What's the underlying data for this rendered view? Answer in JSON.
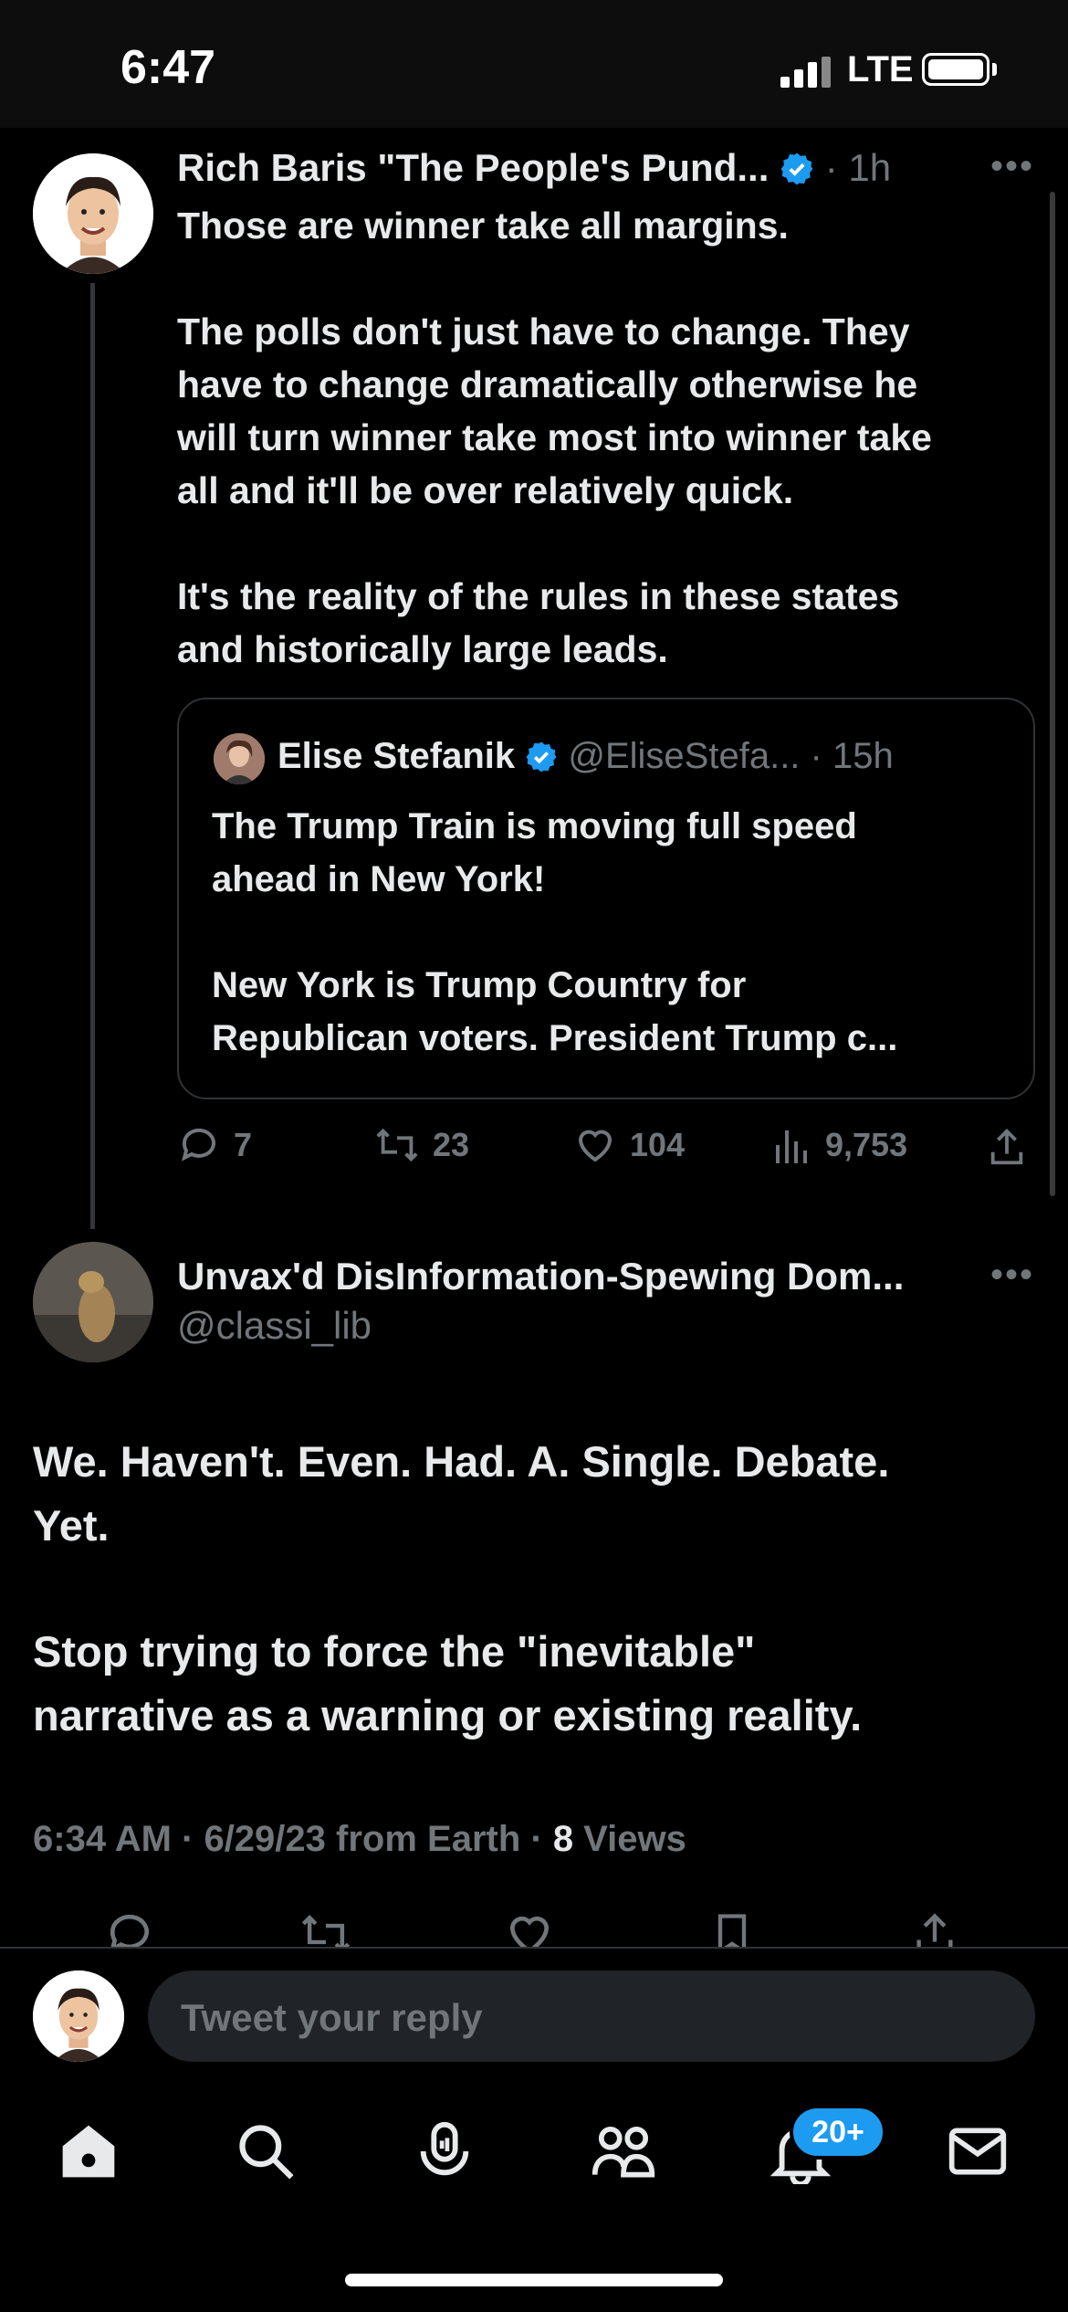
{
  "status_bar": {
    "time": "6:47",
    "network": "LTE"
  },
  "post1": {
    "author_name": "Rich Baris \"The People's Pund...",
    "time": "· 1h",
    "lines": [
      "Those are winner take all margins.",
      "The polls don't just have to change. They",
      "have to change dramatically otherwise he",
      "will turn winner take most into winner take",
      "all and it'll be over relatively quick.",
      "It's the reality of the rules in these states",
      "and historically large leads."
    ],
    "quote": {
      "author_name": "Elise Stefanik",
      "handle": "@EliseStefa...",
      "time": "· 15h",
      "lines": [
        "The Trump Train is moving full speed",
        "ahead in New York!",
        "New York is Trump Country for",
        "Republican voters. President Trump c..."
      ]
    },
    "actions": {
      "replies": "7",
      "retweets": "23",
      "likes": "104",
      "views": "9,753"
    }
  },
  "post2": {
    "author_name": "Unvax'd DisInformation-Spewing Dom...",
    "handle": "@classi_lib",
    "lines": [
      "We. Haven't. Even. Had. A. Single. Debate.",
      "Yet.",
      "Stop trying to force the \"inevitable\"",
      "narrative as a warning or existing reality."
    ],
    "meta": "6:34 AM · 6/29/23 from Earth · ",
    "views_count": "8",
    "views_label": " Views"
  },
  "reply": {
    "placeholder": "Tweet your reply"
  },
  "tabbar": {
    "notifications_badge": "20+"
  },
  "colors": {
    "accent": "#1d9bf0",
    "background": "#000000",
    "text": "#e7e9ea",
    "muted": "#71767b"
  },
  "icons": [
    "home-icon",
    "search-icon",
    "spaces-icon",
    "communities-icon",
    "bell-icon",
    "mail-icon",
    "reply-icon",
    "retweet-icon",
    "like-icon",
    "views-icon",
    "share-icon",
    "bookmark-icon",
    "verified-icon",
    "more-icon"
  ]
}
